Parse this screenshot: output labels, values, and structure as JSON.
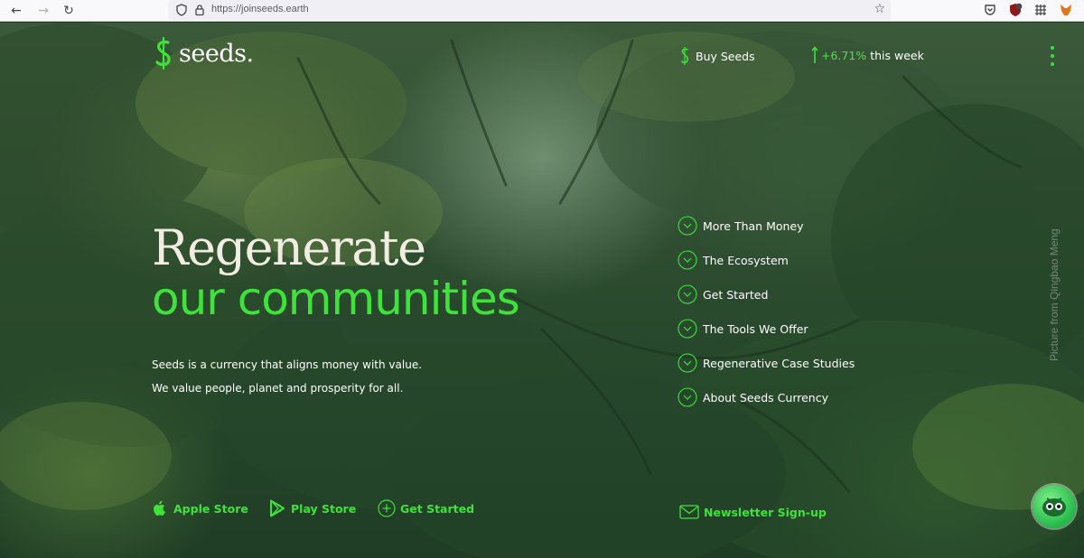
{
  "browser": {
    "url": "https://joinseeds.earth"
  },
  "brand": {
    "logo_text": "seeds."
  },
  "header": {
    "buy_label": "Buy Seeds",
    "trend_pct": "+6.71%",
    "trend_period": "this week"
  },
  "hero": {
    "headline_1": "Regenerate",
    "headline_2": "our communities",
    "sub_1": "Seeds is a currency that aligns money with value.",
    "sub_2": "We value people, planet and prosperity for all."
  },
  "menu": {
    "items": [
      {
        "label": "More Than Money"
      },
      {
        "label": "The Ecosystem"
      },
      {
        "label": "Get Started"
      },
      {
        "label": "The Tools We Offer"
      },
      {
        "label": "Regenerative Case Studies"
      },
      {
        "label": "About Seeds Currency"
      }
    ]
  },
  "credit": "Picture from Qingbao Meng",
  "bottom": {
    "apple": "Apple Store",
    "play": "Play Store",
    "get_started": "Get Started",
    "newsletter": "Newsletter Sign-up"
  },
  "icons": {
    "back": "arrow-left-icon",
    "forward": "arrow-right-icon",
    "reload": "reload-icon",
    "chevron": "chevron-down-icon",
    "apple": "apple-icon",
    "play": "play-store-icon",
    "mail": "mail-icon"
  },
  "colors": {
    "accent": "#3ee23a",
    "headline_cream": "#f1ede2",
    "forest_dark": "#1f3d25"
  }
}
